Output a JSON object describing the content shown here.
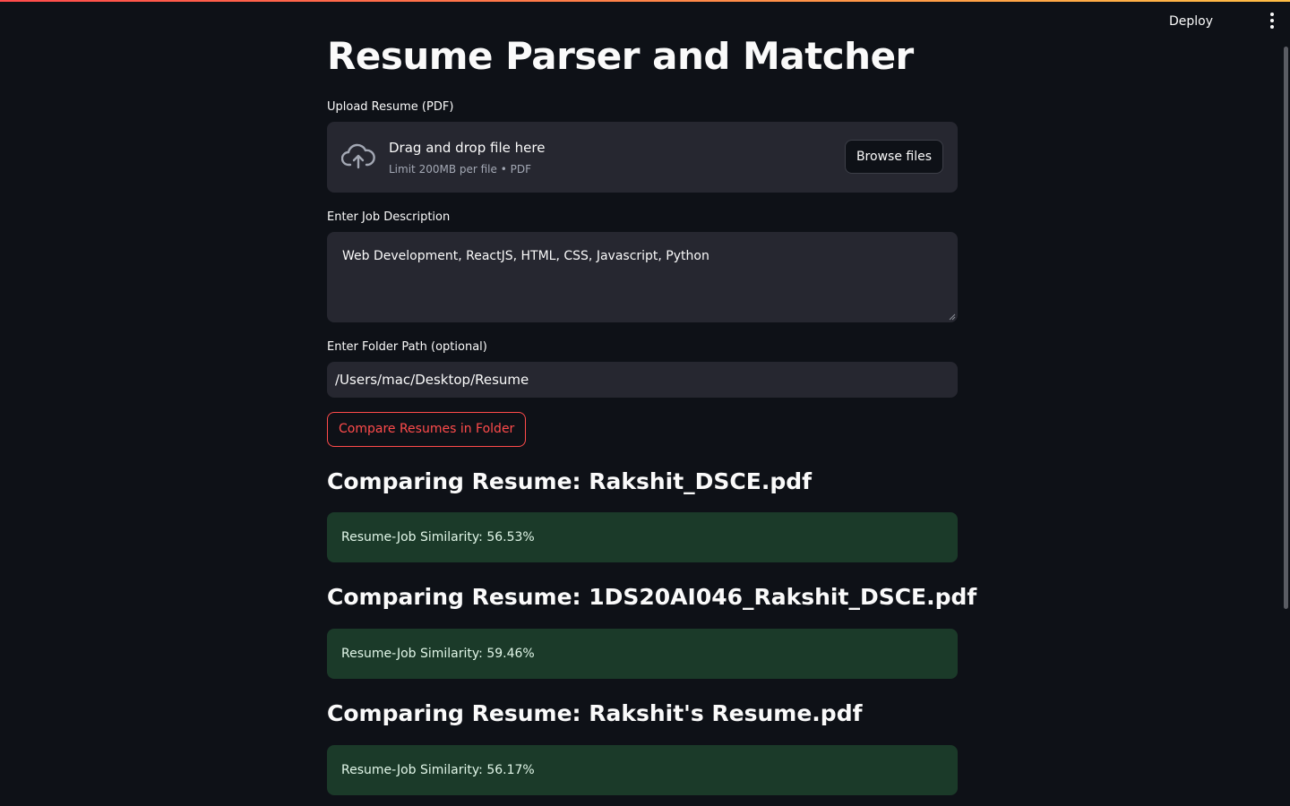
{
  "header": {
    "deploy_label": "Deploy"
  },
  "page": {
    "title": "Resume Parser and Matcher"
  },
  "uploader": {
    "label": "Upload Resume (PDF)",
    "dropzone_title": "Drag and drop file here",
    "dropzone_limit": "Limit 200MB per file • PDF",
    "browse_label": "Browse files"
  },
  "job_description": {
    "label": "Enter Job Description",
    "value": "Web Development, ReactJS, HTML, CSS, Javascript, Python"
  },
  "folder_path": {
    "label": "Enter Folder Path (optional)",
    "value": "/Users/mac/Desktop/Resume"
  },
  "compare_button": {
    "label": "Compare Resumes in Folder"
  },
  "results": [
    {
      "heading": "Comparing Resume: Rakshit_DSCE.pdf",
      "similarity": "Resume-Job Similarity: 56.53%"
    },
    {
      "heading": "Comparing Resume: 1DS20AI046_Rakshit_DSCE.pdf",
      "similarity": "Resume-Job Similarity: 59.46%"
    },
    {
      "heading": "Comparing Resume: Rakshit's Resume.pdf",
      "similarity": "Resume-Job Similarity: 56.17%"
    }
  ],
  "colors": {
    "background": "#0e1117",
    "widget_background": "#262730",
    "primary": "#ff4b4b",
    "success_background": "#1b3a29"
  },
  "icons": {
    "upload": "cloud-upload-icon",
    "menu": "more-vertical-icon"
  }
}
